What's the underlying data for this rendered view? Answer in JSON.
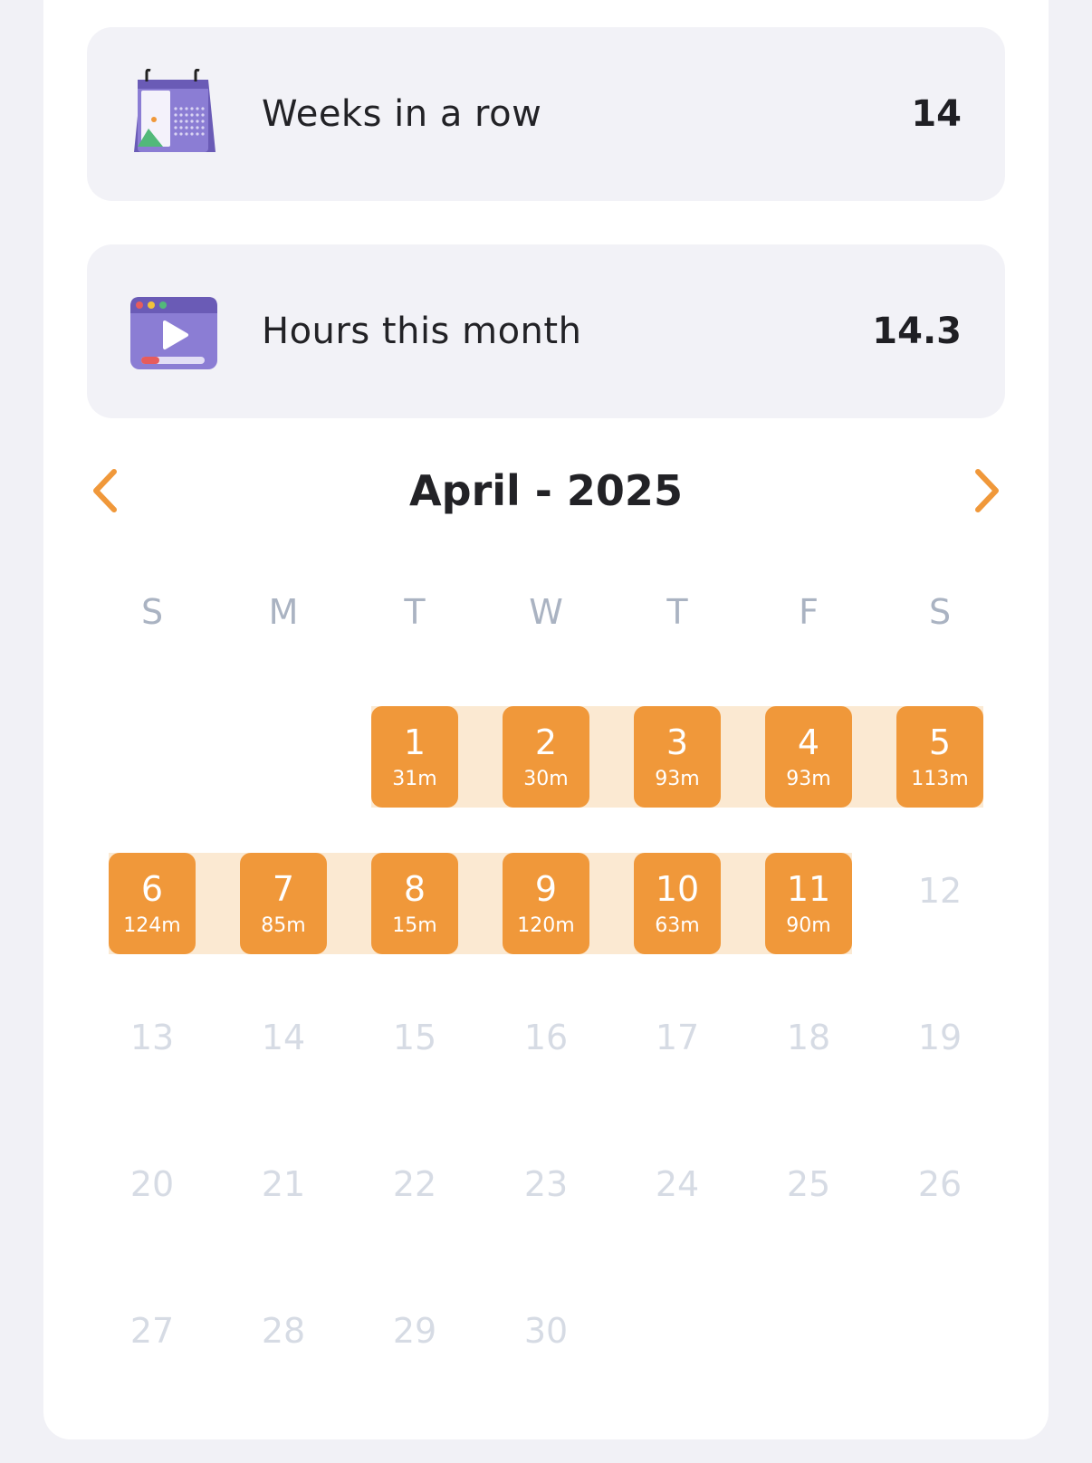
{
  "stats": {
    "weeks": {
      "label": "Weeks in a row",
      "value": "14",
      "icon": "calendar-icon"
    },
    "hours": {
      "label": "Hours this month",
      "value": "14.3",
      "icon": "video-player-icon"
    }
  },
  "calendar": {
    "title": "April - 2025",
    "prev_icon": "chevron-left-icon",
    "next_icon": "chevron-right-icon",
    "weekdays": [
      "S",
      "M",
      "T",
      "W",
      "T",
      "F",
      "S"
    ],
    "active_days": [
      {
        "day": "1",
        "minutes": "31m"
      },
      {
        "day": "2",
        "minutes": "30m"
      },
      {
        "day": "3",
        "minutes": "93m"
      },
      {
        "day": "4",
        "minutes": "93m"
      },
      {
        "day": "5",
        "minutes": "113m"
      },
      {
        "day": "6",
        "minutes": "124m"
      },
      {
        "day": "7",
        "minutes": "85m"
      },
      {
        "day": "8",
        "minutes": "15m"
      },
      {
        "day": "9",
        "minutes": "120m"
      },
      {
        "day": "10",
        "minutes": "63m"
      },
      {
        "day": "11",
        "minutes": "90m"
      }
    ],
    "inactive_days": [
      "12",
      "13",
      "14",
      "15",
      "16",
      "17",
      "18",
      "19",
      "20",
      "21",
      "22",
      "23",
      "24",
      "25",
      "26",
      "27",
      "28",
      "29",
      "30"
    ]
  },
  "colors": {
    "accent": "#f0983a",
    "streak_band": "#fbe9d2",
    "card_bg": "#f2f2f7",
    "weekday_text": "#aab3c2",
    "inactive_day_text": "#d6dbe4",
    "icon_purple": "#7b6cc4"
  }
}
